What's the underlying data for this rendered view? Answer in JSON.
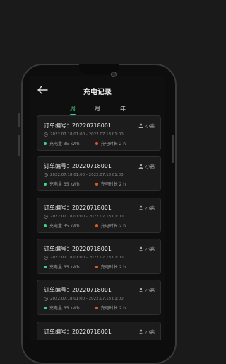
{
  "header": {
    "title": "充电记录",
    "back_icon": "arrow-left-icon"
  },
  "tabs": [
    "周",
    "月",
    "年"
  ],
  "active_tab": 0,
  "colors": {
    "accent_green": "#3fd28a",
    "dot_orange": "#e05a2a"
  },
  "records": [
    {
      "order_label": "订单编号：",
      "order_no": "20220718001",
      "user": "小高",
      "time": "2022.07.18  01:00 - 2022.07.18  01:00",
      "energy": "充电量 35 kWh",
      "duration": "充电时长 2 h"
    },
    {
      "order_label": "订单编号：",
      "order_no": "20220718001",
      "user": "小高",
      "time": "2022.07.18  01:00 - 2022.07.18  01:00",
      "energy": "充电量 35 kWh",
      "duration": "充电时长 2 h"
    },
    {
      "order_label": "订单编号：",
      "order_no": "20220718001",
      "user": "小高",
      "time": "2022.07.18  01:00 - 2022.07.18  01:00",
      "energy": "充电量 35 kWh",
      "duration": "充电时长 2 h"
    },
    {
      "order_label": "订单编号：",
      "order_no": "20220718001",
      "user": "小高",
      "time": "2022.07.18  01:00 - 2022.07.18  01:00",
      "energy": "充电量 35 kWh",
      "duration": "充电时长 2 h"
    },
    {
      "order_label": "订单编号：",
      "order_no": "20220718001",
      "user": "小高",
      "time": "2022.07.18  01:00 - 2022.07.18  01:00",
      "energy": "充电量 35 kWh",
      "duration": "充电时长 2 h"
    },
    {
      "order_label": "订单编号：",
      "order_no": "20220718001",
      "user": "小高",
      "time": "",
      "energy": "",
      "duration": ""
    }
  ]
}
